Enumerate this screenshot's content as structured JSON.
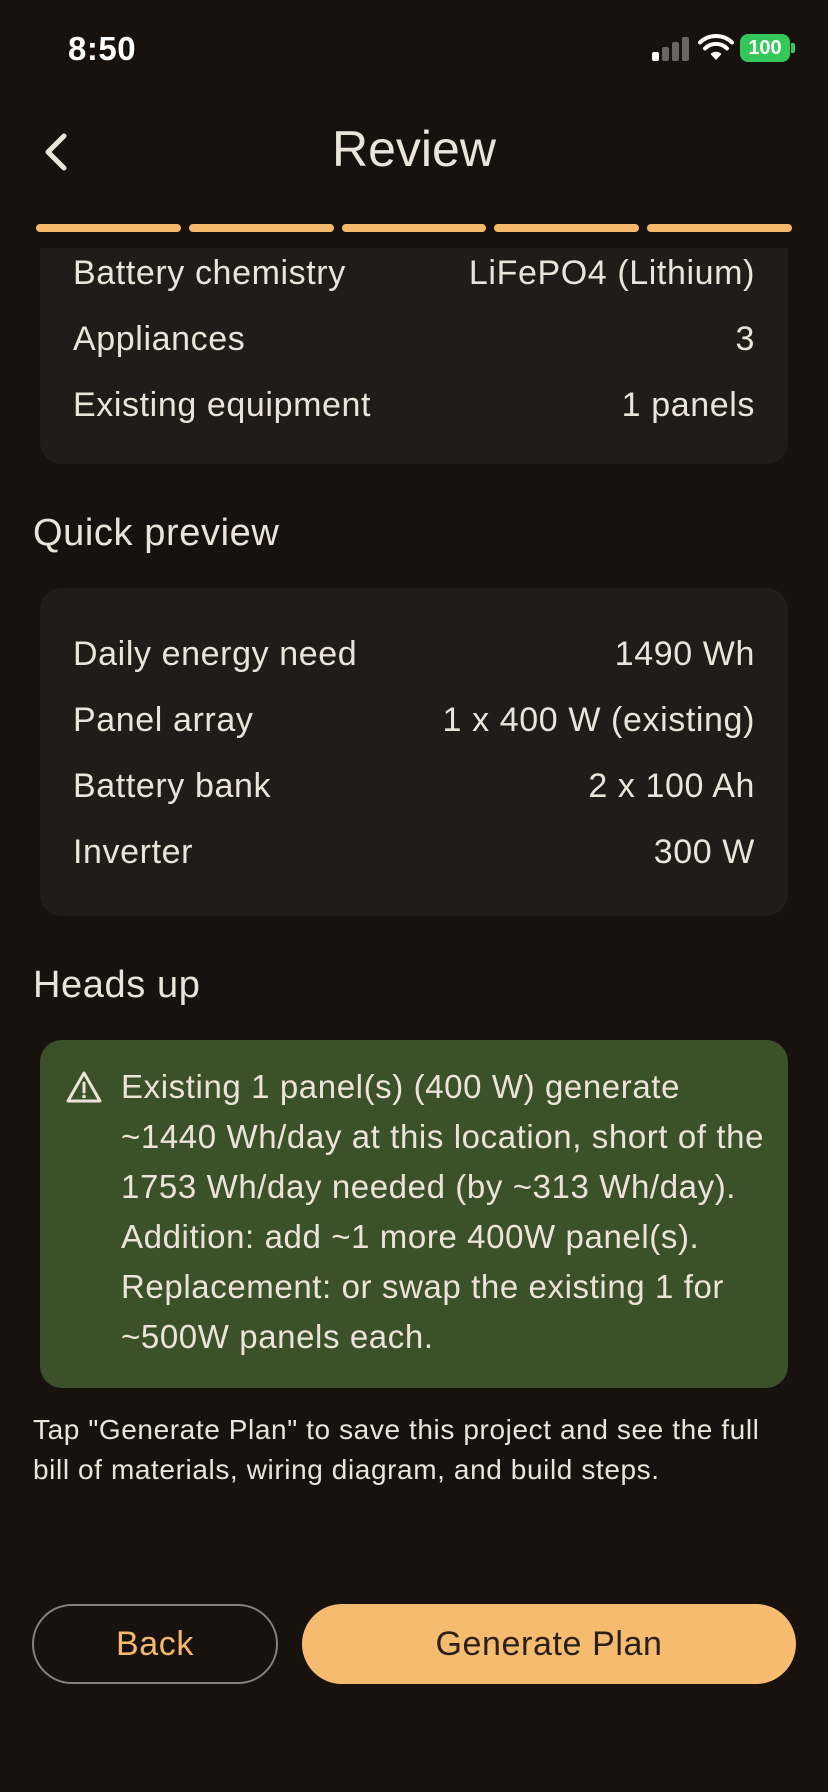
{
  "status_bar": {
    "time": "8:50",
    "battery_level": "100",
    "signal_bars_active": 1,
    "signal_bars_total": 4
  },
  "header": {
    "title": "Review",
    "back_icon": "chevron-left-icon"
  },
  "progress": {
    "steps_total": 5,
    "steps_completed": 5,
    "accent_color": "#f5b96c"
  },
  "summary": {
    "rows": [
      {
        "label": "Battery chemistry",
        "value": "LiFePO4 (Lithium)"
      },
      {
        "label": "Appliances",
        "value": "3"
      },
      {
        "label": "Existing equipment",
        "value": "1 panels"
      }
    ]
  },
  "quick_preview": {
    "title": "Quick preview",
    "rows": [
      {
        "label": "Daily energy need",
        "value": "1490 Wh"
      },
      {
        "label": "Panel array",
        "value": "1 x 400 W (existing)"
      },
      {
        "label": "Battery bank",
        "value": "2 x 100 Ah"
      },
      {
        "label": "Inverter",
        "value": "300 W"
      }
    ]
  },
  "heads_up": {
    "title": "Heads up",
    "icon": "warning-triangle-icon",
    "message": "Existing 1 panel(s) (400 W) generate ~1440 Wh/day at this location, short of the 1753 Wh/day needed (by ~313 Wh/day). Addition: add ~1 more 400W panel(s). Replacement: or swap the existing 1 for ~500W panels each.",
    "background_color": "#3a5129"
  },
  "footer_note": "Tap \"Generate Plan\" to save this project and see the full bill of materials, wiring diagram, and build steps.",
  "actions": {
    "back_label": "Back",
    "generate_label": "Generate Plan"
  },
  "colors": {
    "background": "#18120f",
    "card": "#221c18",
    "text": "#ece4d9",
    "accent": "#f5bc70"
  }
}
